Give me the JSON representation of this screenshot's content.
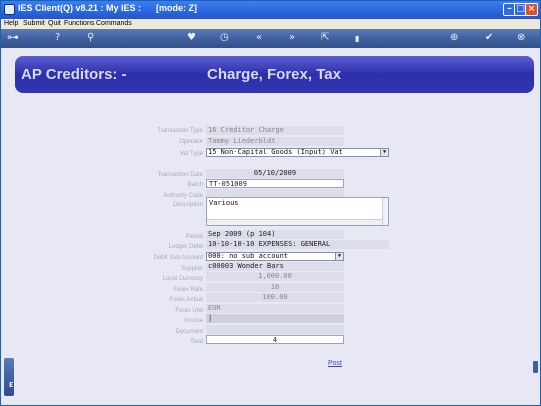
{
  "window": {
    "title": "IES Client(Q) v8.21 : My IES :      [mode: Z]",
    "minimize_glyph": "–",
    "maximize_glyph": "□",
    "close_glyph": "×"
  },
  "menu": [
    "Help",
    "Submit",
    "Quit",
    "Functions",
    "Commands"
  ],
  "toolbar": {
    "icons": [
      {
        "name": "key-icon",
        "glyph": "⊶"
      },
      {
        "name": "help-icon",
        "glyph": "?"
      },
      {
        "name": "search-icon",
        "glyph": "⚲"
      },
      {
        "name": "heart-icon",
        "glyph": "♥"
      },
      {
        "name": "clock-icon",
        "glyph": "◷"
      },
      {
        "name": "rewind-icon",
        "glyph": "«"
      },
      {
        "name": "fast-forward-icon",
        "glyph": "»"
      },
      {
        "name": "export-icon",
        "glyph": "⇱"
      },
      {
        "name": "trash-icon",
        "glyph": "▮"
      },
      {
        "name": "add-icon",
        "glyph": "⊕"
      },
      {
        "name": "check-icon",
        "glyph": "✔"
      },
      {
        "name": "cancel-icon",
        "glyph": "⊗"
      }
    ]
  },
  "banner": {
    "left": "AP Creditors: -",
    "right": "Charge, Forex, Tax"
  },
  "form": {
    "labels": {
      "transaction_type": "Transaction Type",
      "operator": "Operator",
      "vat_type": "Vat Type",
      "transaction_date": "Transaction Date",
      "batch": "Batch",
      "authority_code": "Authority Code",
      "description": "Description",
      "period": "Period",
      "ledger_debit": "Ledger Debit",
      "debit_sub_account": "Debit Sub Account",
      "supplier": "Supplier",
      "local_currency": "Local Currency",
      "forex_rate": "Forex Rate",
      "forex_actual": "Forex Actual",
      "forex_unit": "Forex Unit",
      "invoice": "Invoice",
      "document": "Document",
      "seat": "Seat"
    },
    "values": {
      "transaction_type": "16 Creditor Charge",
      "operator": "Tammy Liederbldt",
      "vat_type": "15 Non-Capital Goods (Input) Vat",
      "transaction_date": "05/10/2009",
      "batch": "TT-051009",
      "authority_code": "",
      "description": "Various",
      "period": "Sep 2009 (p 104)",
      "ledger_debit": "10-10-10-10 EXPENSES: GENERAL",
      "debit_sub_account": "000: no sub account",
      "supplier": "c00003 Wonder Bars",
      "local_currency": "1,000.00",
      "forex_rate": "10",
      "forex_actual": "100.00",
      "forex_unit": "EUR",
      "invoice": "|",
      "document": "",
      "seat": "4"
    }
  },
  "actions": {
    "post": "Post"
  }
}
